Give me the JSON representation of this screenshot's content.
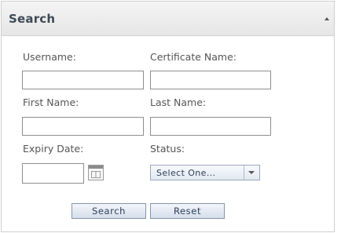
{
  "panel": {
    "title": "Search"
  },
  "fields": {
    "username": {
      "label": "Username:",
      "value": ""
    },
    "certificate_name": {
      "label": "Certificate Name:",
      "value": ""
    },
    "first_name": {
      "label": "First Name:",
      "value": ""
    },
    "last_name": {
      "label": "Last Name:",
      "value": ""
    },
    "expiry_date": {
      "label": "Expiry Date:",
      "value": ""
    },
    "status": {
      "label": "Status:",
      "selected": "Select One..."
    }
  },
  "buttons": {
    "search": "Search",
    "reset": "Reset"
  },
  "icons": {
    "collapse": "collapse-up-icon",
    "calendar": "calendar-icon",
    "dropdown": "chevron-down-icon"
  }
}
